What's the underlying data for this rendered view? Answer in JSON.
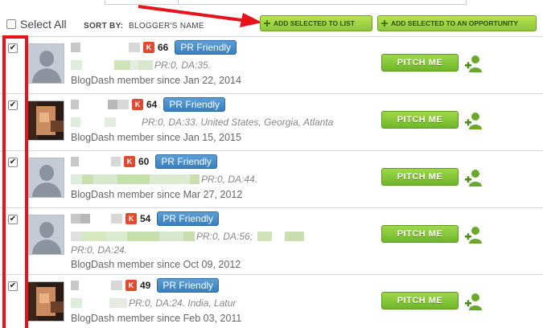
{
  "toolbar": {
    "select_all_label": "Select All",
    "sort_by_label": "SORT BY:",
    "sort_value": "BLOGGER'S NAME",
    "add_to_list_label": "ADD SELECTED TO LIST",
    "add_to_opportunity_label": "ADD SELECTED TO AN OPPORTUNITY"
  },
  "bloggers": [
    {
      "score": "66",
      "badge": "PR Friendly",
      "stats": "PR:0, DA:35.",
      "since": "BlogDash member since Jan 22, 2014",
      "pitch": "PITCH ME",
      "checked": "✔"
    },
    {
      "score": "64",
      "badge": "PR Friendly",
      "stats": "PR:0, DA:33. United States, Georgia, Atlanta",
      "since": "BlogDash member since Jan 15, 2015",
      "pitch": "PITCH ME",
      "checked": "✔"
    },
    {
      "score": "60",
      "badge": "PR Friendly",
      "stats": "PR:0, DA:44.",
      "since": "BlogDash member since Mar 27, 2012",
      "pitch": "PITCH ME",
      "checked": "✔"
    },
    {
      "score": "54",
      "badge": "PR Friendly",
      "stats": "PR:0, DA:56;",
      "stats2": "PR:0, DA:24.",
      "since": "BlogDash member since Oct 09, 2012",
      "pitch": "PITCH ME",
      "checked": "✔"
    },
    {
      "score": "49",
      "badge": "PR Friendly",
      "stats": "PR:0, DA:24. India, Latur",
      "since": "BlogDash member since Feb 03, 2011",
      "pitch": "PITCH ME",
      "checked": "✔"
    }
  ],
  "colors": {
    "highlight": "#e8121a",
    "klout": "#e24a30",
    "badge": "#3a7fbf",
    "pitch": "#7ac132"
  },
  "icons": {
    "klout": "klout-icon",
    "add_user": "add-user-icon",
    "plus": "plus-icon",
    "arrow": "red-arrow-annotation"
  }
}
